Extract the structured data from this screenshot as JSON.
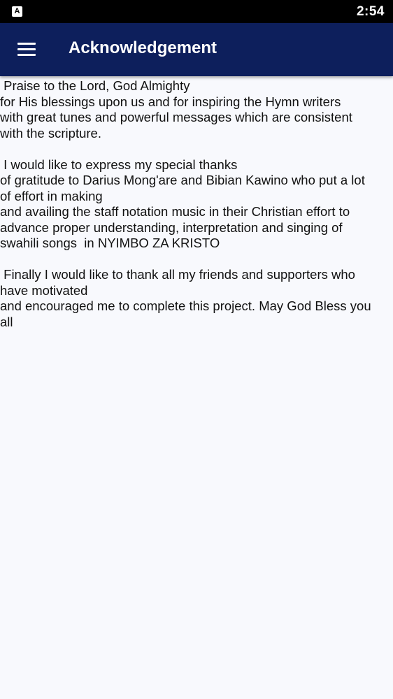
{
  "status_bar": {
    "app_icon_letter": "A",
    "time": "2:54"
  },
  "app_bar": {
    "menu_icon": "hamburger-menu-icon",
    "title": "Acknowledgement"
  },
  "paragraphs": [
    {
      "lines": [
        " Praise to the Lord, God Almighty",
        "for His blessings upon us and for inspiring the Hymn writers",
        "with great tunes and powerful messages which are consistent",
        "with the scripture."
      ]
    },
    {
      "lines": [
        " I would like to express my special thanks",
        "of gratitude to Darius Mong'are and Bibian Kawino who put a lot",
        "of effort in making",
        "and availing the staff notation music in their Christian effort to",
        "advance proper understanding, interpretation and singing of",
        "swahili songs  in NYIMBO ZA KRISTO"
      ]
    },
    {
      "lines": [
        " Finally I would like to thank all my friends and supporters who",
        "have motivated",
        "and encouraged me to complete this project. May God Bless you",
        "all"
      ]
    }
  ],
  "colors": {
    "app_bar": "#0d1f5c",
    "status_bar": "#000000",
    "background": "#f8f9fd",
    "text": "#111111"
  }
}
